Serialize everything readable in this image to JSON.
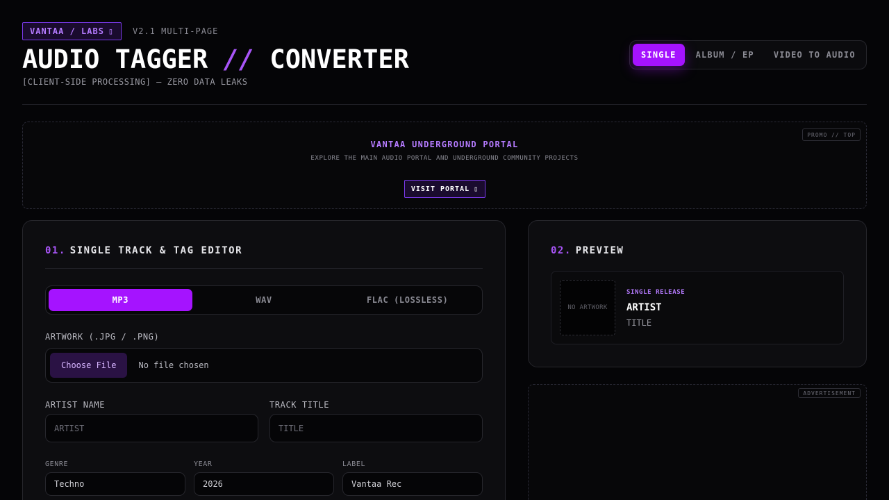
{
  "header": {
    "brand": "VANTAA / LABS",
    "brand_icon": "external-link-icon",
    "version": "V2.1 MULTI-PAGE",
    "title_part1": "AUDIO TAGGER ",
    "title_slash": "//",
    "title_part2": " CONVERTER",
    "subtitle": "[CLIENT-SIDE PROCESSING] — ZERO DATA LEAKS"
  },
  "mode_tabs": [
    {
      "label": "SINGLE",
      "active": true
    },
    {
      "label": "ALBUM / EP",
      "active": false
    },
    {
      "label": "VIDEO TO AUDIO",
      "active": false
    }
  ],
  "promo": {
    "tag": "PROMO // TOP",
    "title": "VANTAA UNDERGROUND PORTAL",
    "description": "EXPLORE THE MAIN AUDIO PORTAL AND UNDERGROUND COMMUNITY PROJECTS",
    "button": "VISIT PORTAL"
  },
  "editor": {
    "num": "01.",
    "heading": "SINGLE TRACK & TAG EDITOR",
    "formats": [
      {
        "label": "MP3",
        "active": true
      },
      {
        "label": "WAV",
        "active": false
      },
      {
        "label": "FLAC (LOSSLESS)",
        "active": false
      }
    ],
    "artwork_label": "ARTWORK (.JPG / .PNG)",
    "file_button": "Choose File",
    "file_status": "No file chosen",
    "artist_label": "ARTIST NAME",
    "artist_placeholder": "ARTIST",
    "title_label": "TRACK TITLE",
    "title_placeholder": "TITLE",
    "genre_label": "GENRE",
    "genre_value": "Techno",
    "year_label": "YEAR",
    "year_value": "2026",
    "label_label": "LABEL",
    "label_value": "Vantaa Rec"
  },
  "preview": {
    "num": "02.",
    "heading": "PREVIEW",
    "artwork_placeholder": "NO ARTWORK",
    "release_type": "SINGLE RELEASE",
    "artist": "ARTIST",
    "title": "TITLE"
  },
  "ad": {
    "tag": "ADVERTISEMENT"
  },
  "colors": {
    "accent": "#a513ff",
    "accent_text": "#b57bff",
    "background": "#050507"
  }
}
